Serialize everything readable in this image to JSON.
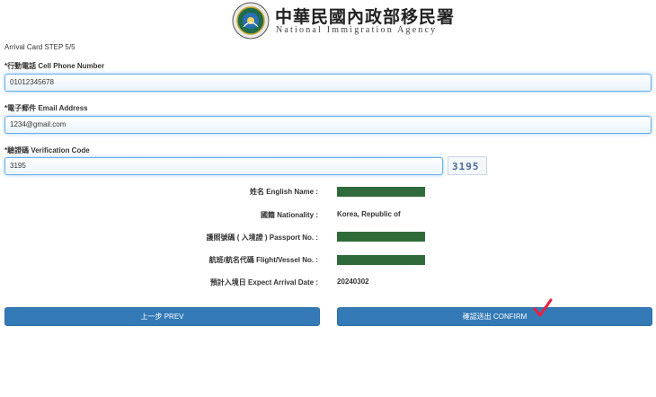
{
  "header": {
    "org_name_zh": "中華民國內政部移民署",
    "org_name_en": "National Immigration Agency"
  },
  "step_title": "Arrival Card STEP 5/5",
  "form": {
    "phone_label": "*行動電話 Cell Phone Number",
    "phone_value": "01012345678",
    "email_label": "*電子郵件 Email Address",
    "email_value": "1234@gmail.com",
    "code_label": "*驗證碼 Verification Code",
    "code_value": "3195",
    "captcha_text": "3195"
  },
  "summary": [
    {
      "label": "姓名 English Name :",
      "value": "",
      "redacted": true
    },
    {
      "label": "國籍 Nationality :",
      "value": "Korea, Republic of",
      "redacted": false
    },
    {
      "label": "護照號碼 ( 入境證 ) Passport No. :",
      "value": "",
      "redacted": true
    },
    {
      "label": "航班/航名代碼 Flight/Vessel No. :",
      "value": "",
      "redacted": true
    },
    {
      "label": "預計入境日 Expect Arrival Date :",
      "value": "20240302",
      "redacted": false
    }
  ],
  "buttons": {
    "prev_label": "上一步 PREV",
    "confirm_label": "確認送出 CONFIRM"
  },
  "colors": {
    "primary": "#337ab7",
    "input_focus": "#66afe9",
    "redaction": "#2f6b3a",
    "checkmark": "#e8213f"
  },
  "icons": {
    "logo": "immigration-agency-emblem",
    "check": "red-checkmark-annotation"
  }
}
